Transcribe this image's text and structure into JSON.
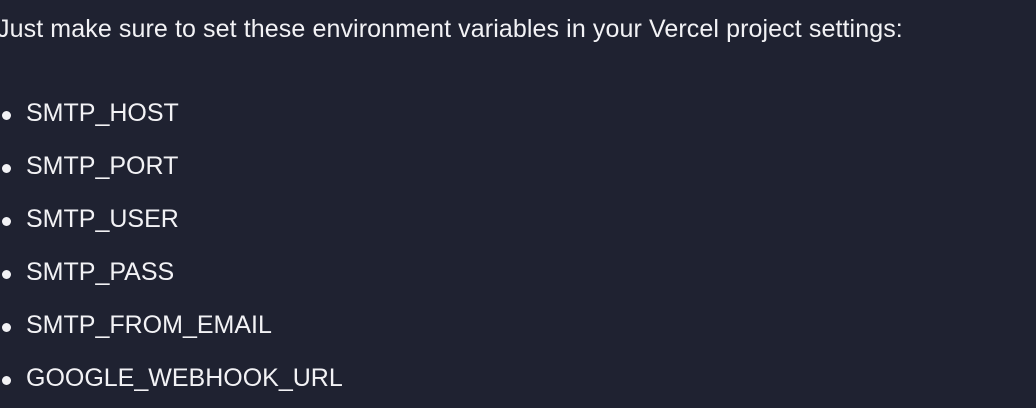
{
  "message": {
    "intro": "Just make sure to set these environment variables in your Vercel project settings:",
    "env_vars": [
      "SMTP_HOST",
      "SMTP_PORT",
      "SMTP_USER",
      "SMTP_PASS",
      "SMTP_FROM_EMAIL",
      "GOOGLE_WEBHOOK_URL"
    ]
  },
  "colors": {
    "background": "#1f2231",
    "text": "#f2f2f5"
  }
}
